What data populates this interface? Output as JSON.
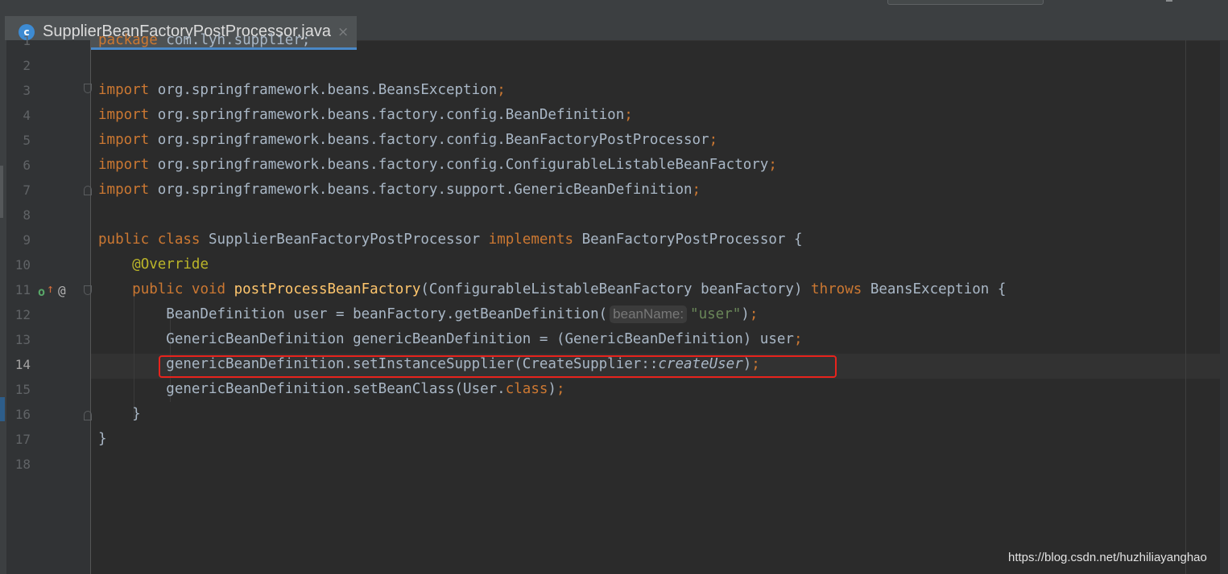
{
  "editor": {
    "tab": {
      "icon_letter": "c",
      "title": "SupplierBeanFactoryPostProcessor.java",
      "close": "×"
    },
    "current_line": "14",
    "gutter_icons": {
      "implements": "o",
      "override_arrow": "↑",
      "at": "@"
    },
    "lines": [
      {
        "no": "1",
        "parts": [
          [
            "kw",
            "package"
          ],
          [
            "p",
            " com.lyh.supplier;"
          ]
        ]
      },
      {
        "no": "2",
        "parts": []
      },
      {
        "no": "3",
        "parts": [
          [
            "kw",
            "import"
          ],
          [
            "p",
            " org.springframework.beans.BeansException"
          ],
          [
            "kw",
            ";"
          ]
        ]
      },
      {
        "no": "4",
        "parts": [
          [
            "kw",
            "import"
          ],
          [
            "p",
            " org.springframework.beans.factory.config.BeanDefinition"
          ],
          [
            "kw",
            ";"
          ]
        ]
      },
      {
        "no": "5",
        "parts": [
          [
            "kw",
            "import"
          ],
          [
            "p",
            " org.springframework.beans.factory.config.BeanFactoryPostProcessor"
          ],
          [
            "kw",
            ";"
          ]
        ]
      },
      {
        "no": "6",
        "parts": [
          [
            "kw",
            "import"
          ],
          [
            "p",
            " org.springframework.beans.factory.config.ConfigurableListableBeanFactory"
          ],
          [
            "kw",
            ";"
          ]
        ]
      },
      {
        "no": "7",
        "parts": [
          [
            "kw",
            "import"
          ],
          [
            "p",
            " org.springframework.beans.factory.support.GenericBeanDefinition"
          ],
          [
            "kw",
            ";"
          ]
        ]
      },
      {
        "no": "8",
        "parts": []
      },
      {
        "no": "9",
        "parts": [
          [
            "kw",
            "public class "
          ],
          [
            "p",
            "SupplierBeanFactoryPostProcessor "
          ],
          [
            "kw",
            "implements "
          ],
          [
            "p",
            "BeanFactoryPostProcessor {"
          ]
        ]
      },
      {
        "no": "10",
        "parts": [
          [
            "p",
            "    "
          ],
          [
            "ann",
            "@Override"
          ]
        ]
      },
      {
        "no": "11",
        "parts": [
          [
            "p",
            "    "
          ],
          [
            "kw",
            "public void "
          ],
          [
            "fn",
            "postProcessBeanFactory"
          ],
          [
            "p",
            "(ConfigurableListableBeanFactory beanFactory) "
          ],
          [
            "kw",
            "throws "
          ],
          [
            "p",
            "BeansException {"
          ]
        ]
      },
      {
        "no": "12",
        "parts": [
          [
            "p",
            "        BeanDefinition user = beanFactory.getBeanDefinition("
          ],
          [
            "hint",
            "beanName:"
          ],
          [
            "str",
            "\"user\""
          ],
          [
            "p",
            ")"
          ],
          [
            "kw",
            ";"
          ]
        ]
      },
      {
        "no": "13",
        "parts": [
          [
            "p",
            "        GenericBeanDefinition genericBeanDefinition = (GenericBeanDefinition) user"
          ],
          [
            "kw",
            ";"
          ]
        ]
      },
      {
        "no": "14",
        "parts": [
          [
            "p",
            "        genericBeanDefinition."
          ],
          [
            "sym",
            "setInstanceSupplier"
          ],
          [
            "p",
            "(CreateSupplier::"
          ],
          [
            "it",
            "createUser"
          ],
          [
            "p",
            ")"
          ],
          [
            "kw",
            ";"
          ]
        ]
      },
      {
        "no": "15",
        "parts": [
          [
            "p",
            "        genericBeanDefinition.setBeanClass(User."
          ],
          [
            "kw",
            "class"
          ],
          [
            "p",
            ")"
          ],
          [
            "kw",
            ";"
          ]
        ]
      },
      {
        "no": "16",
        "parts": [
          [
            "p",
            "    }"
          ]
        ]
      },
      {
        "no": "17",
        "parts": [
          [
            "p",
            "}"
          ]
        ]
      },
      {
        "no": "18",
        "parts": []
      }
    ]
  },
  "watermark": "https://blog.csdn.net/huzhiliayanghao",
  "colors": {
    "background": "#2b2b2b",
    "keyword": "#cc7832",
    "annotation": "#bbb529",
    "string": "#6a8759",
    "method_declaration": "#ffc66d",
    "plain": "#a9b7c6",
    "highlight_box": "#e8231c",
    "tab_underline": "#4a88c7"
  }
}
